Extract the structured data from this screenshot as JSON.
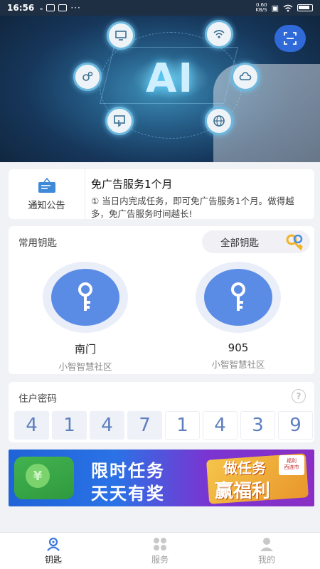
{
  "status_bar": {
    "time": "16:56",
    "network_top": "0.60",
    "network_bottom": "KB/S"
  },
  "notice": {
    "icon_label": "通知公告",
    "title": "免广告服务1个月",
    "description": "① 当日内完成任务，即可免广告服务1个月。做得越多，免广告服务时间越长!"
  },
  "keys": {
    "header": "常用钥匙",
    "all_keys_label": "全部钥匙",
    "items": [
      {
        "name": "南门",
        "community": "小智智慧社区"
      },
      {
        "name": "905",
        "community": "小智智慧社区"
      }
    ]
  },
  "password": {
    "header": "住户密码",
    "digits": [
      "4",
      "1",
      "4",
      "7",
      "1",
      "4",
      "3",
      "9"
    ],
    "filled_count": 4
  },
  "promo": {
    "line1": "限时任务",
    "line2": "天天有奖",
    "badge_line1": "做任务",
    "badge_line2": "赢福利",
    "tag": "福利\n西连市"
  },
  "banner": {
    "text": "AI"
  },
  "tabs": [
    {
      "label": "钥匙",
      "icon": "key-person-icon",
      "active": true
    },
    {
      "label": "服务",
      "icon": "grid-icon",
      "active": false
    },
    {
      "label": "我的",
      "icon": "user-icon",
      "active": false
    }
  ],
  "colors": {
    "primary": "#2f6ad8",
    "key_blue": "#5a8ce6",
    "digit_text": "#5e7fbf"
  }
}
